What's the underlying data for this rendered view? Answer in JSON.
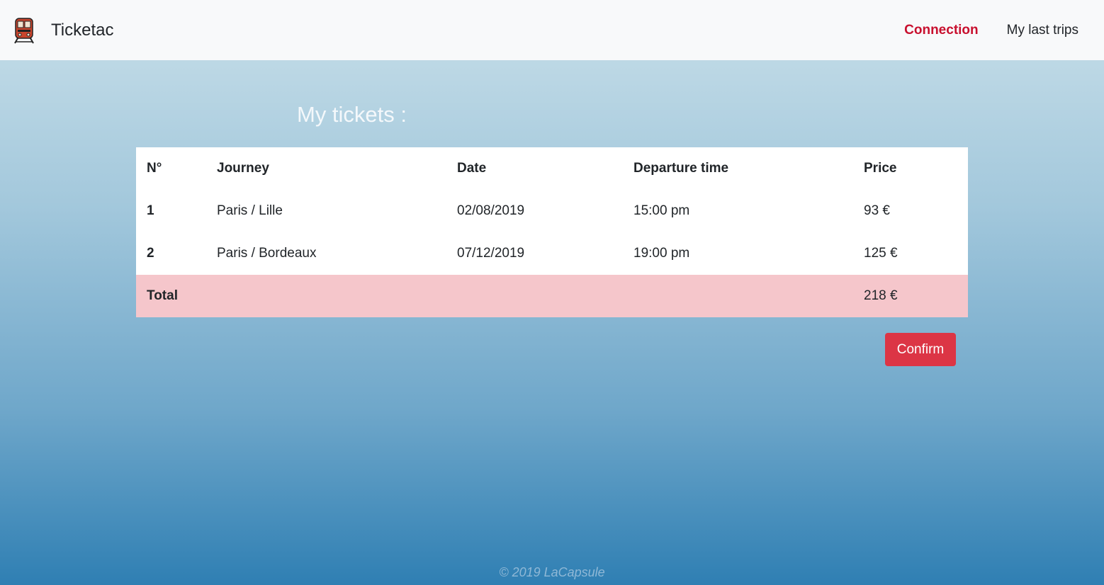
{
  "navbar": {
    "brand": "Ticketac",
    "logo_icon": "train-icon",
    "links": [
      {
        "label": "Connection",
        "active": true
      },
      {
        "label": "My last trips",
        "active": false
      }
    ]
  },
  "main": {
    "title": "My tickets :",
    "table": {
      "headers": [
        "N°",
        "Journey",
        "Date",
        "Departure time",
        "Price"
      ],
      "rows": [
        [
          "1",
          "Paris / Lille",
          "02/08/2019",
          "15:00 pm",
          "93 €"
        ],
        [
          "2",
          "Paris / Bordeaux",
          "07/12/2019",
          "19:00 pm",
          "125 €"
        ]
      ],
      "total_label": "Total",
      "total_value": "218 €"
    },
    "confirm_label": "Confirm"
  },
  "footer": {
    "text": "© 2019 LaCapsule"
  },
  "colors": {
    "accent": "#dc3545",
    "active_link": "#c8102e",
    "total_row": "#f5c6cb",
    "navbar_bg": "#f8f9fa"
  }
}
